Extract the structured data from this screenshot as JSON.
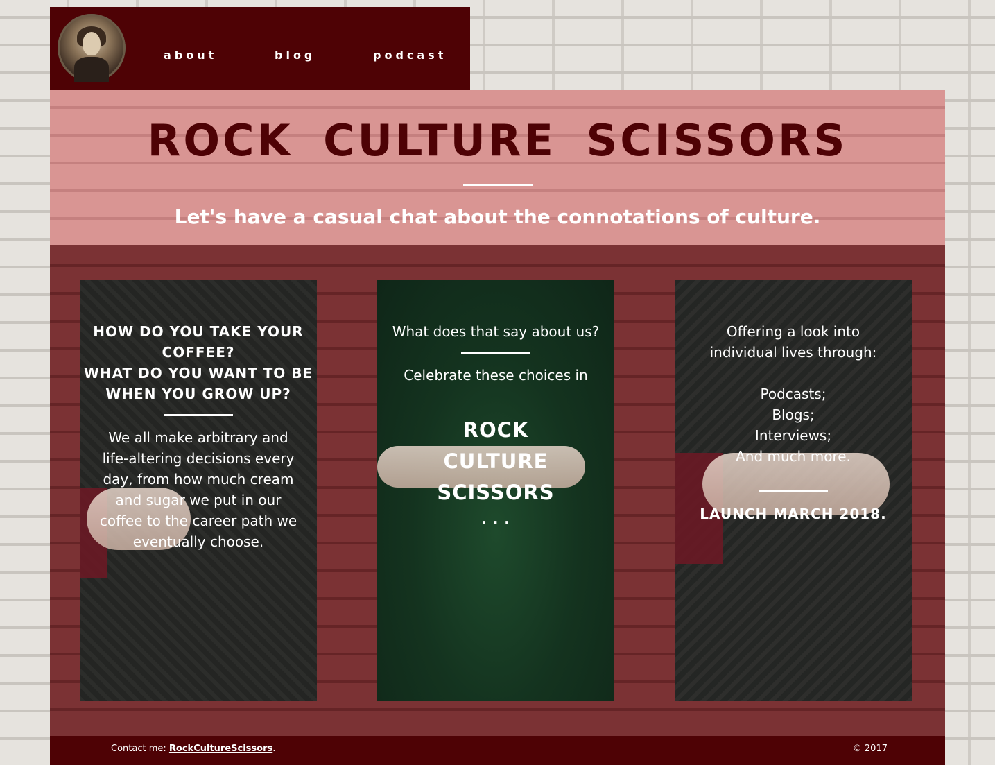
{
  "nav": {
    "items": [
      "about",
      "blog",
      "podcast"
    ]
  },
  "hero": {
    "title": "ROCK CULTURE SCISSORS",
    "tagline": "Let's have a casual chat about the connotations of culture."
  },
  "cards": [
    {
      "heading_lines": [
        "HOW DO YOU TAKE YOUR",
        "COFFEE?",
        "WHAT DO YOU WANT TO BE",
        "WHEN YOU GROW UP?"
      ],
      "body_lines": [
        "We all make arbitrary and",
        "life-altering decisions every",
        "day, from how much cream",
        "and sugar we put in our",
        "coffee to the career path we",
        "eventually choose."
      ]
    },
    {
      "intro": "What does that say about us?",
      "celebrate": "Celebrate these choices in",
      "title_lines": [
        "ROCK",
        "CULTURE",
        "SCISSORS"
      ],
      "ellipsis": ". . ."
    },
    {
      "intro_lines": [
        "Offering a look into",
        "individual lives through:"
      ],
      "list": [
        "Podcasts;",
        "Blogs;",
        "Interviews;",
        "And much more."
      ],
      "launch": "LAUNCH MARCH 2018."
    }
  ],
  "footer": {
    "contact_label": "Contact me:",
    "contact_link": "RockCultureScissors",
    "contact_end": ".",
    "copyright": "© 2017"
  },
  "colors": {
    "nav_bg": "#4e0205",
    "hero_bg": "#d99593",
    "main_bg": "#7b3234",
    "title": "#4e0205"
  }
}
